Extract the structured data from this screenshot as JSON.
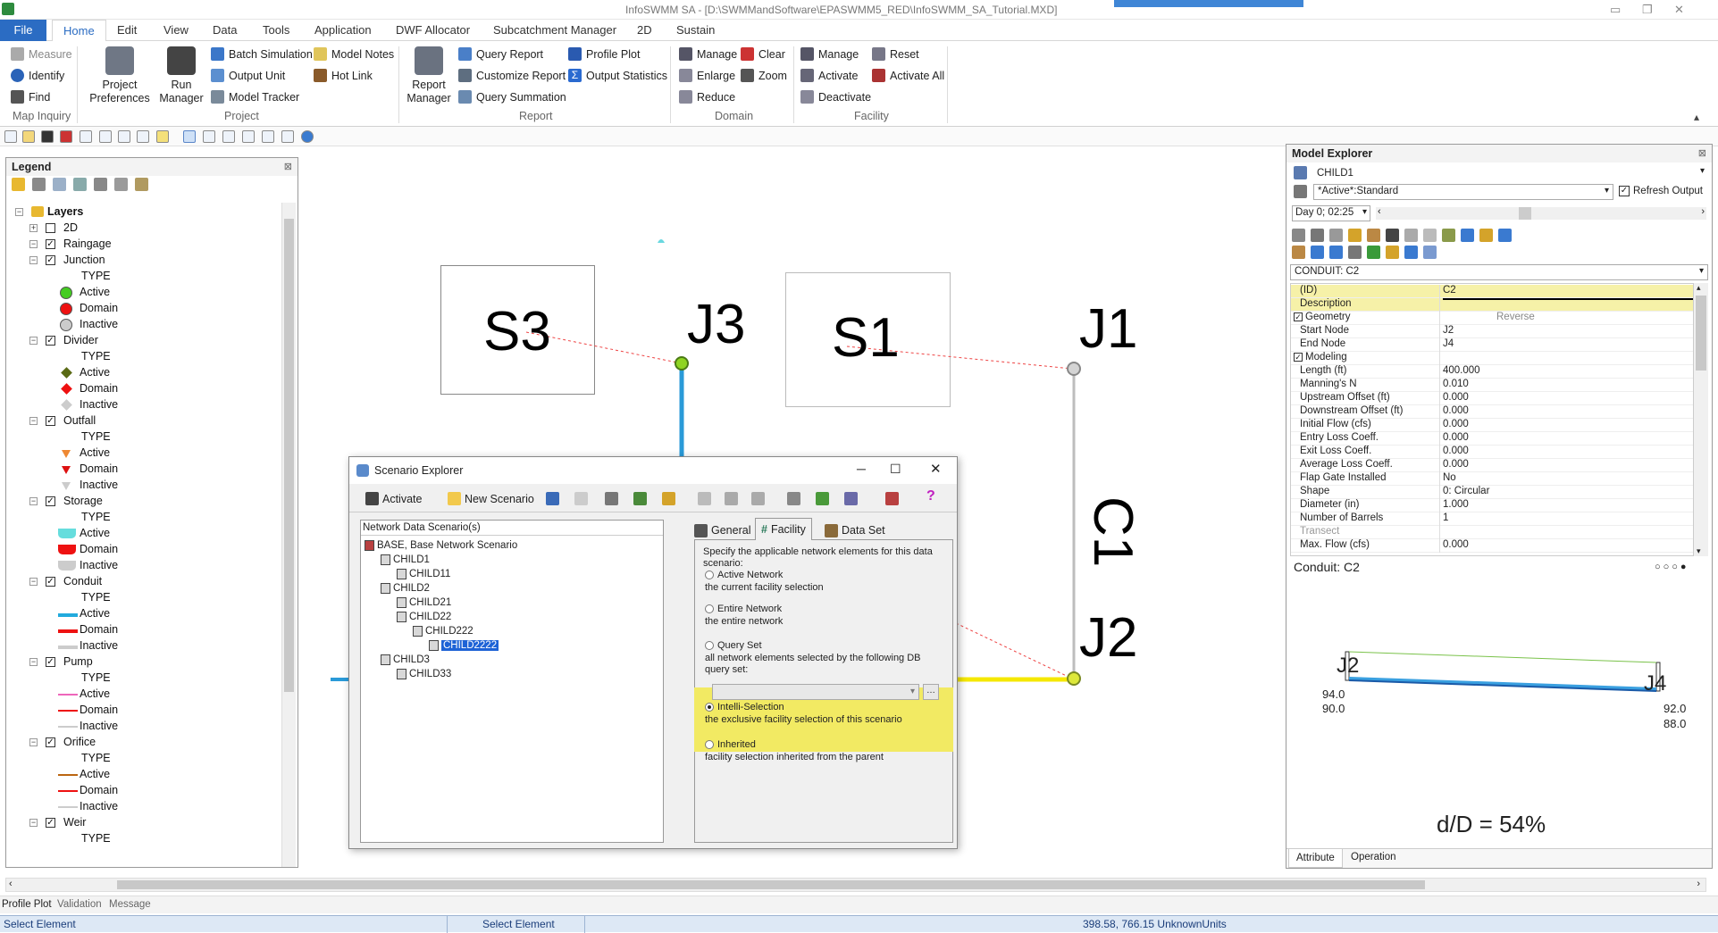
{
  "window": {
    "title": "InfoSWMM SA - [D:\\SWMMandSoftware\\EPASWMM5_RED\\InfoSWMM_SA_Tutorial.MXD]"
  },
  "tabs": [
    "File",
    "Home",
    "Edit",
    "View",
    "Data",
    "Tools",
    "Application",
    "DWF Allocator",
    "Subcatchment Manager",
    "2D",
    "Sustain"
  ],
  "ribbon": {
    "map_inquiry": {
      "measure": "Measure",
      "identify": "Identify",
      "find": "Find",
      "label": "Map Inquiry"
    },
    "project": {
      "preferences": "Project Preferences",
      "run_manager": "Run Manager",
      "batch_simulation": "Batch Simulation",
      "output_unit": "Output Unit",
      "model_tracker": "Model Tracker",
      "model_notes": "Model Notes",
      "hot_link": "Hot Link",
      "label": "Project"
    },
    "report": {
      "report_manager": "Report Manager",
      "query_report": "Query Report",
      "customize_report": "Customize Report",
      "query_summation": "Query Summation",
      "profile_plot": "Profile Plot",
      "output_statistics": "Output Statistics",
      "label": "Report"
    },
    "domain": {
      "manage": "Manage",
      "enlarge": "Enlarge",
      "reduce": "Reduce",
      "clear": "Clear",
      "zoom": "Zoom",
      "label": "Domain"
    },
    "facility": {
      "manage": "Manage",
      "activate": "Activate",
      "deactivate": "Deactivate",
      "reset": "Reset",
      "activate_all": "Activate All",
      "label": "Facility"
    }
  },
  "legend": {
    "title": "Legend",
    "rows": [
      {
        "text": "Layers",
        "bold": true,
        "indent": 0
      },
      {
        "text": "2D",
        "indent": 1,
        "checked": false
      },
      {
        "text": "Raingage",
        "indent": 1,
        "checked": true
      },
      {
        "text": "Junction",
        "indent": 1,
        "checked": true
      },
      {
        "text": "TYPE",
        "indent": 2
      },
      {
        "text": "Active",
        "indent": 2,
        "sym": "circle",
        "color": "#44cc22"
      },
      {
        "text": "Domain",
        "indent": 2,
        "sym": "circle",
        "color": "#ee1111"
      },
      {
        "text": "Inactive",
        "indent": 2,
        "sym": "circle",
        "color": "#cccccc"
      },
      {
        "text": "Divider",
        "indent": 1,
        "checked": true
      },
      {
        "text": "TYPE",
        "indent": 2
      },
      {
        "text": "Active",
        "indent": 2,
        "sym": "diamond",
        "color": "#5a6a14"
      },
      {
        "text": "Domain",
        "indent": 2,
        "sym": "diamond",
        "color": "#ee1111"
      },
      {
        "text": "Inactive",
        "indent": 2,
        "sym": "diamond",
        "color": "#cccccc"
      },
      {
        "text": "Outfall",
        "indent": 1,
        "checked": true
      },
      {
        "text": "TYPE",
        "indent": 2
      },
      {
        "text": "Active",
        "indent": 2,
        "sym": "tri",
        "color": "#ee8833"
      },
      {
        "text": "Domain",
        "indent": 2,
        "sym": "tri",
        "color": "#dd1111"
      },
      {
        "text": "Inactive",
        "indent": 2,
        "sym": "tri",
        "color": "#cccccc"
      },
      {
        "text": "Storage",
        "indent": 1,
        "checked": true
      },
      {
        "text": "TYPE",
        "indent": 2
      },
      {
        "text": "Active",
        "indent": 2,
        "sym": "tank",
        "color": "#66dddd"
      },
      {
        "text": "Domain",
        "indent": 2,
        "sym": "tank",
        "color": "#ee1111"
      },
      {
        "text": "Inactive",
        "indent": 2,
        "sym": "tank",
        "color": "#cccccc"
      },
      {
        "text": "Conduit",
        "indent": 1,
        "checked": true
      },
      {
        "text": "TYPE",
        "indent": 2
      },
      {
        "text": "Active",
        "indent": 2,
        "sym": "line",
        "color": "#22aadd"
      },
      {
        "text": "Domain",
        "indent": 2,
        "sym": "line",
        "color": "#ee1111"
      },
      {
        "text": "Inactive",
        "indent": 2,
        "sym": "line",
        "color": "#cccccc"
      },
      {
        "text": "Pump",
        "indent": 1,
        "checked": true
      },
      {
        "text": "TYPE",
        "indent": 2
      },
      {
        "text": "Active",
        "indent": 2,
        "sym": "thin",
        "color": "#ee66bb"
      },
      {
        "text": "Domain",
        "indent": 2,
        "sym": "thin",
        "color": "#ee1111"
      },
      {
        "text": "Inactive",
        "indent": 2,
        "sym": "thin",
        "color": "#cccccc"
      },
      {
        "text": "Orifice",
        "indent": 1,
        "checked": true
      },
      {
        "text": "TYPE",
        "indent": 2
      },
      {
        "text": "Active",
        "indent": 2,
        "sym": "thin",
        "color": "#bb6611"
      },
      {
        "text": "Domain",
        "indent": 2,
        "sym": "thin",
        "color": "#ee1111"
      },
      {
        "text": "Inactive",
        "indent": 2,
        "sym": "thin",
        "color": "#cccccc"
      },
      {
        "text": "Weir",
        "indent": 1,
        "checked": true
      },
      {
        "text": "TYPE",
        "indent": 2
      }
    ]
  },
  "map": {
    "labels": {
      "s3": "S3",
      "j3": "J3",
      "s1": "S1",
      "j1": "J1",
      "c1": "C1",
      "j2": "J2"
    }
  },
  "dialog": {
    "title": "Scenario Explorer",
    "activate": "Activate",
    "new_scenario": "New Scenario",
    "tree_header": "Network Data Scenario(s)",
    "tree": [
      {
        "text": "BASE, Base Network Scenario",
        "level": 0
      },
      {
        "text": "CHILD1",
        "level": 1
      },
      {
        "text": "CHILD11",
        "level": 2
      },
      {
        "text": "CHILD2",
        "level": 1
      },
      {
        "text": "CHILD21",
        "level": 2
      },
      {
        "text": "CHILD22",
        "level": 2
      },
      {
        "text": "CHILD222",
        "level": 3
      },
      {
        "text": "CHILD2222",
        "level": 4,
        "selected": true
      },
      {
        "text": "CHILD3",
        "level": 1
      },
      {
        "text": "CHILD33",
        "level": 2
      }
    ],
    "tabs": [
      "General",
      "Facility",
      "Data Set"
    ],
    "intro": "Specify the applicable network elements for this data scenario:",
    "options": [
      {
        "title": "Active Network",
        "desc": "the current facility selection",
        "checked": false
      },
      {
        "title": "Entire Network",
        "desc": "the entire network",
        "checked": false
      },
      {
        "title": "Query Set",
        "desc": "all network elements selected by the following DB query set:",
        "checked": false
      },
      {
        "title": "Intelli-Selection",
        "desc": "the exclusive facility selection of this scenario",
        "checked": true
      },
      {
        "title": "Inherited",
        "desc": "facility selection inherited from the parent",
        "checked": false
      }
    ]
  },
  "model_explorer": {
    "title": "Model Explorer",
    "scenario": "CHILD1",
    "output": "*Active*:Standard",
    "refresh_output": "Refresh Output",
    "time": "Day 0;  02:25",
    "element": "CONDUIT: C2",
    "props": [
      {
        "k": "(ID)",
        "v": "C2",
        "hl": true
      },
      {
        "k": "Description",
        "v": "",
        "hl": true
      },
      {
        "k": "Geometry",
        "v": "Reverse",
        "section": true
      },
      {
        "k": "Start Node",
        "v": "J2"
      },
      {
        "k": "End Node",
        "v": "J4"
      },
      {
        "k": "Modeling",
        "v": "",
        "section": true
      },
      {
        "k": "Length (ft)",
        "v": "400.000"
      },
      {
        "k": "Manning's N",
        "v": "0.010"
      },
      {
        "k": "Upstream Offset (ft)",
        "v": "0.000"
      },
      {
        "k": "Downstream Offset (ft)",
        "v": "0.000"
      },
      {
        "k": "Initial Flow (cfs)",
        "v": "0.000"
      },
      {
        "k": "Entry Loss Coeff.",
        "v": "0.000"
      },
      {
        "k": "Exit Loss Coeff.",
        "v": "0.000"
      },
      {
        "k": "Average Loss Coeff.",
        "v": "0.000"
      },
      {
        "k": "Flap Gate Installed",
        "v": "No"
      },
      {
        "k": "Shape",
        "v": "0: Circular"
      },
      {
        "k": "Diameter (in)",
        "v": "1.000"
      },
      {
        "k": "Number of Barrels",
        "v": "1"
      },
      {
        "k": "Transect",
        "v": "",
        "muted": true
      },
      {
        "k": "Max. Flow (cfs)",
        "v": "0.000"
      }
    ],
    "profile": {
      "title": "Conduit: C2",
      "up_node": "J2",
      "down_node": "J4",
      "up_top": "94.0",
      "up_bottom": "90.0",
      "down_top": "92.0",
      "down_bottom": "88.0",
      "ratio": "d/D = 54%"
    },
    "bottom_tabs": [
      "Attribute",
      "Operation"
    ]
  },
  "bottom_tabs": [
    "Profile Plot",
    "Validation",
    "Message"
  ],
  "status": {
    "left": "Select Element",
    "middle": "Select Element",
    "coords": "398.58, 766.15  UnknownUnits"
  }
}
